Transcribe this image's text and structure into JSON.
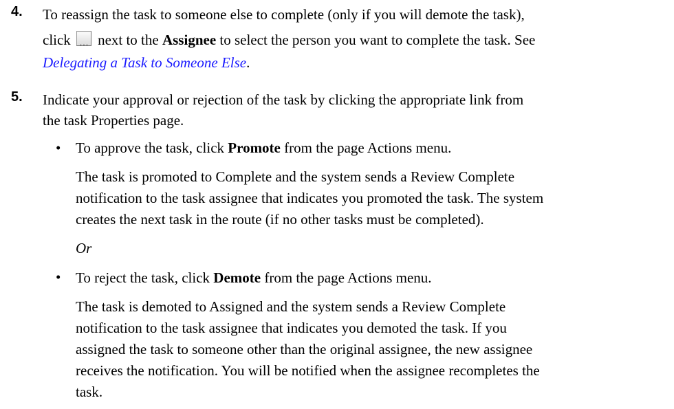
{
  "step4": {
    "number": "4.",
    "line1": "To reassign the task to someone else to complete (only if you will demote the task),",
    "click": "click",
    "after_icon": "next to the",
    "assignee_label": "Assignee",
    "after_assignee": "to select the person you want to complete the task. See",
    "link_text": "Delegating a Task to Someone Else",
    "end": "."
  },
  "step5": {
    "number": "5.",
    "line1": "Indicate your approval or rejection of the task by clicking the appropriate link from",
    "line2": "the task Properties page.",
    "bullet_a": {
      "before": "To approve the task, click",
      "action": "Promote",
      "after": "from the page Actions menu.",
      "desc1": "The task is promoted to Complete and the system sends a Review Complete",
      "desc2": "notification to the task assignee that indicates you promoted the task. The system",
      "desc3": "creates the next task in the route (if no other tasks must be completed)."
    },
    "or_text": "Or",
    "bullet_b": {
      "before": "To reject the task, click",
      "action": "Demote",
      "after": "from the page Actions menu.",
      "desc1": "The task is demoted to Assigned and the system sends a Review Complete",
      "desc2": "notification to the task assignee that indicates you demoted the task. If you",
      "desc3": "assigned the task to someone other than the original assignee, the new assignee",
      "desc4": "receives the notification. You will be notified when the assignee recompletes the",
      "desc5": "task."
    }
  },
  "icons": {
    "assignee_chooser": "ellipsis-button-icon"
  }
}
